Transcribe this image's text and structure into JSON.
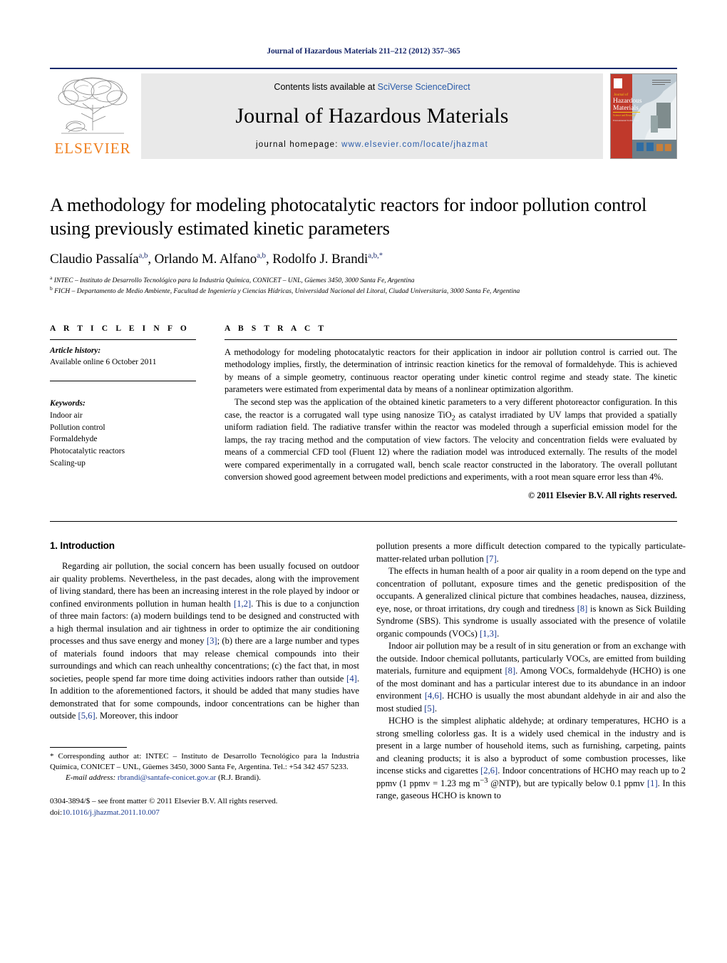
{
  "running_head": "Journal of Hazardous Materials 211–212 (2012) 357–365",
  "masthead": {
    "publisher": "ELSEVIER",
    "contents_prefix": "Contents lists available at ",
    "contents_link": "SciVerse ScienceDirect",
    "journal_title": "Journal of Hazardous Materials",
    "homepage_prefix": "journal homepage: ",
    "homepage_url": "www.elsevier.com/locate/jhazmat",
    "cover_title_line1": "Journal of",
    "cover_title_line2": "Hazardous",
    "cover_title_line3": "Materials",
    "cover_subtitle": "Science and Research",
    "cover_tagline": "Environmental Technologies"
  },
  "article": {
    "title": "A methodology for modeling photocatalytic reactors for indoor pollution control using previously estimated kinetic parameters",
    "authors_html": "Claudio Passalía<sup>a,b</sup>, Orlando M. Alfano<sup>a,b</sup>, Rodolfo J. Brandi<sup>a,b,*</sup>",
    "affiliation_a": "INTEC – Instituto de Desarrollo Tecnológico para la Industria Química, CONICET – UNL, Güemes 3450, 3000 Santa Fe, Argentina",
    "affiliation_b": "FICH – Departamento de Medio Ambiente, Facultad de Ingeniería y Ciencias Hídricas, Universidad Nacional del Litoral, Ciudad Universitaria, 3000 Santa Fe, Argentina"
  },
  "article_info": {
    "heading": "A R T I C L E   I N F O",
    "history_label": "Article history:",
    "history_value": "Available online 6 October 2011",
    "keywords_label": "Keywords:",
    "keywords": [
      "Indoor air",
      "Pollution control",
      "Formaldehyde",
      "Photocatalytic reactors",
      "Scaling-up"
    ]
  },
  "abstract": {
    "heading": "A B S T R A C T",
    "paragraph_1": "A methodology for modeling photocatalytic reactors for their application in indoor air pollution control is carried out. The methodology implies, firstly, the determination of intrinsic reaction kinetics for the removal of formaldehyde. This is achieved by means of a simple geometry, continuous reactor operating under kinetic control regime and steady state. The kinetic parameters were estimated from experimental data by means of a nonlinear optimization algorithm.",
    "paragraph_2_part1": "The second step was the application of the obtained kinetic parameters to a very different photoreactor configuration. In this case, the reactor is a corrugated wall type using nanosize TiO",
    "paragraph_2_sub": "2",
    "paragraph_2_part2": " as catalyst irradiated by UV lamps that provided a spatially uniform radiation field. The radiative transfer within the reactor was modeled through a superficial emission model for the lamps, the ray tracing method and the computation of view factors. The velocity and concentration fields were evaluated by means of a commercial CFD tool (Fluent 12) where the radiation model was introduced externally. The results of the model were compared experimentally in a corrugated wall, bench scale reactor constructed in the laboratory. The overall pollutant conversion showed good agreement between model predictions and experiments, with a root mean square error less than 4%.",
    "copyright": "© 2011 Elsevier B.V. All rights reserved."
  },
  "body": {
    "section_number_title": "1.  Introduction",
    "left_p1_a": "Regarding air pollution, the social concern has been usually focused on outdoor air quality problems. Nevertheless, in the past decades, along with the improvement of living standard, there has been an increasing interest in the role played by indoor or confined environments pollution in human health ",
    "left_p1_ref1": "[1,2]",
    "left_p1_b": ". This is due to a conjunction of three main factors: (a) modern buildings tend to be designed and constructed with a high thermal insulation and air tightness in order to optimize the air conditioning processes and thus save energy and money ",
    "left_p1_ref2": "[3]",
    "left_p1_c": "; (b) there are a large number and types of materials found indoors that may release chemical compounds into their surroundings and which can reach unhealthy concentrations; (c) the fact that, in most societies, people spend far more time doing activities indoors rather than outside ",
    "left_p1_ref3": "[4]",
    "left_p1_d": ". In addition to the aforementioned factors, it should be added that many studies have demonstrated that for some compounds, indoor concentrations can be higher than outside ",
    "left_p1_ref4": "[5,6]",
    "left_p1_e": ". Moreover, this indoor",
    "right_p1_a": "pollution presents a more difficult detection compared to the typically particulate-matter-related urban pollution ",
    "right_p1_ref1": "[7]",
    "right_p1_b": ".",
    "right_p2_a": "The effects in human health of a poor air quality in a room depend on the type and concentration of pollutant, exposure times and the genetic predisposition of the occupants. A generalized clinical picture that combines headaches, nausea, dizziness, eye, nose, or throat irritations, dry cough and tiredness ",
    "right_p2_ref1": "[8]",
    "right_p2_b": " is known as Sick Building Syndrome (SBS). This syndrome is usually associated with the presence of volatile organic compounds (VOCs) ",
    "right_p2_ref2": "[1,3]",
    "right_p2_c": ".",
    "right_p3_a": "Indoor air pollution may be a result of in situ generation or from an exchange with the outside. Indoor chemical pollutants, particularly VOCs, are emitted from building materials, furniture and equipment ",
    "right_p3_ref1": "[8]",
    "right_p3_b": ". Among VOCs, formaldehyde (HCHO) is one of the most dominant and has a particular interest due to its abundance in an indoor environment ",
    "right_p3_ref2": "[4,6]",
    "right_p3_c": ". HCHO is usually the most abundant aldehyde in air and also the most studied ",
    "right_p3_ref3": "[5]",
    "right_p3_d": ".",
    "right_p4_a": "HCHO is the simplest aliphatic aldehyde; at ordinary temperatures, HCHO is a strong smelling colorless gas. It is a widely used chemical in the industry and is present in a large number of household items, such as furnishing, carpeting, paints and cleaning products; it is also a byproduct of some combustion processes, like incense sticks and cigarettes ",
    "right_p4_ref1": "[2,6]",
    "right_p4_b": ". Indoor concentrations of HCHO may reach up to 2 ppmv (1 ppmv = 1.23 mg m",
    "right_p4_sup": "−3",
    "right_p4_c": " @NTP), but are typically below 0.1 ppmv ",
    "right_p4_ref2": "[1]",
    "right_p4_d": ". In this range, gaseous HCHO is known to"
  },
  "footnote": {
    "corresponding": "* Corresponding author at: INTEC – Instituto de Desarrollo Tecnológico para la Industria Química, CONICET – UNL, Güemes 3450, 3000 Santa Fe, Argentina. Tel.: +54 342 457 5233.",
    "email_label": "E-mail address: ",
    "email_address": "rbrandi@santafe-conicet.gov.ar",
    "email_suffix": " (R.J. Brandi).",
    "issn_line": "0304-3894/$ – see front matter © 2011 Elsevier B.V. All rights reserved.",
    "doi_label": "doi:",
    "doi_value": "10.1016/j.jhazmat.2011.10.007"
  },
  "colors": {
    "link_blue": "#2a5caa",
    "ref_blue": "#1a3a8f",
    "elsevier_orange": "#f08020",
    "band_gray": "#e9e9e9",
    "rule_navy": "#1a2a6c"
  }
}
